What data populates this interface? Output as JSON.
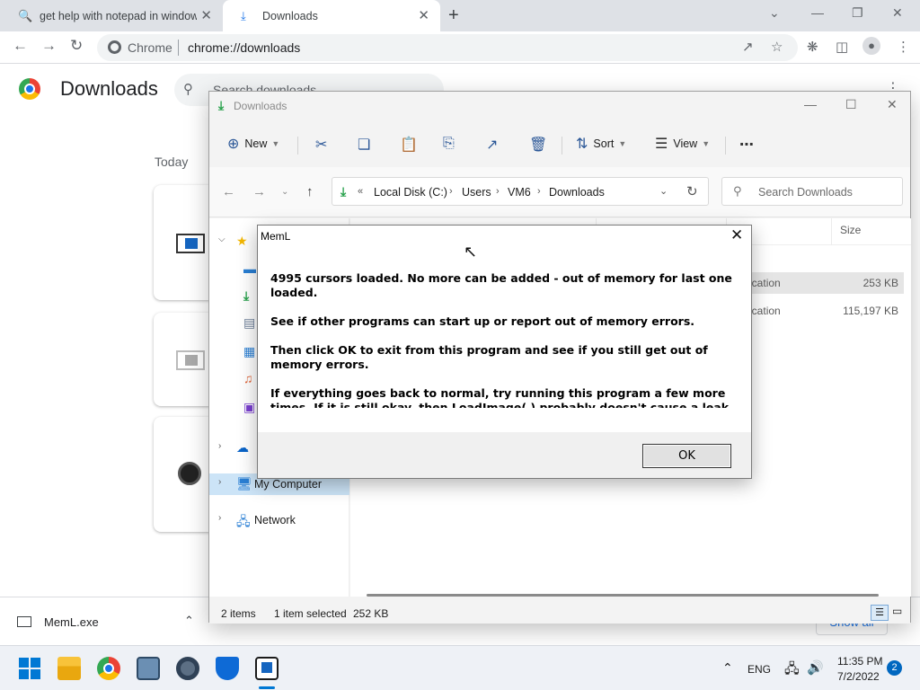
{
  "browser": {
    "tabs": [
      {
        "label": "get help with notepad in window",
        "icon": "search-icon"
      },
      {
        "label": "Downloads",
        "icon": "download-icon"
      }
    ],
    "omnibox": {
      "site": "Chrome",
      "url": "chrome://downloads"
    }
  },
  "downloads_page": {
    "title": "Downloads",
    "search_placeholder": "Search downloads",
    "section": "Today",
    "shelf": {
      "file_name": "MemL.exe",
      "show_all": "Show all"
    }
  },
  "explorer": {
    "title": "Downloads",
    "commands": {
      "new": "New",
      "sort": "Sort",
      "view": "View"
    },
    "breadcrumb": [
      "Local Disk (C:)",
      "Users",
      "VM6",
      "Downloads"
    ],
    "search_placeholder": "Search Downloads",
    "nav": {
      "my_computer": "My Computer",
      "network": "Network"
    },
    "columns": {
      "size": "Size"
    },
    "files": [
      {
        "type": "Application",
        "size": "253 KB"
      },
      {
        "type": "Application",
        "size": "115,197 KB"
      }
    ],
    "status": {
      "items": "2 items",
      "selected": "1 item selected",
      "selected_size": "252 KB"
    }
  },
  "dialog": {
    "title": "MemL",
    "messages": [
      "4995 cursors loaded. No more can be added - out of memory for last one loaded.",
      "See if other programs can start up or report out of memory errors.",
      "Then click OK to exit from this program and see if you still get out of memory errors.",
      "If everything goes back to normal, try running this program a few more times. If it is still okay, then LoadImage( ) probably doesn't cause a leak on"
    ],
    "ok_label": "OK"
  },
  "taskbar": {
    "language": "ENG",
    "time": "11:35 PM",
    "date": "7/2/2022",
    "notification_count": "2"
  },
  "colors": {
    "accent": "#0078d4",
    "chrome_blue": "#1a73e8",
    "download_green": "#27a14b"
  }
}
